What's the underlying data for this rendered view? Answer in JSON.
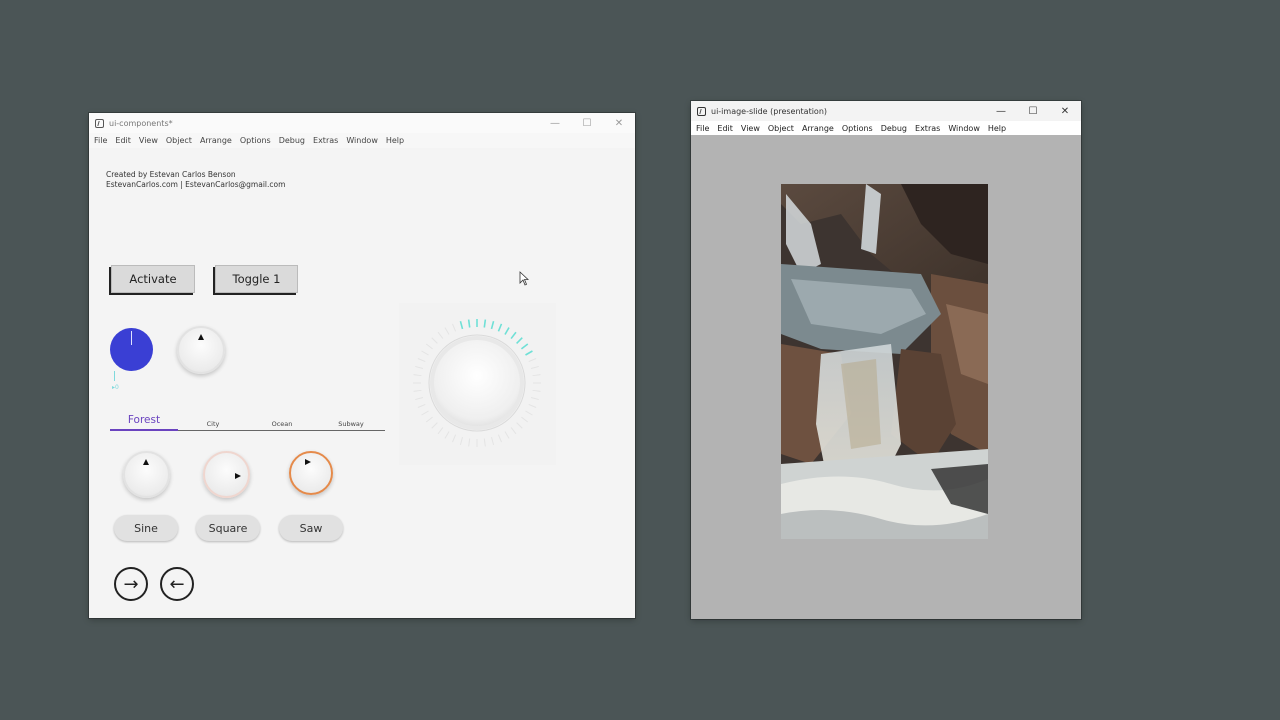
{
  "window1": {
    "title": "ui-components*",
    "menu": [
      "File",
      "Edit",
      "View",
      "Object",
      "Arrange",
      "Options",
      "Debug",
      "Extras",
      "Window",
      "Help"
    ],
    "credit_line1": "Created by Estevan Carlos Benson",
    "credit_line2": "EstevanCarlos.com | EstevanCarlos@gmail.com",
    "buttons": {
      "activate": "Activate",
      "toggle": "Toggle 1"
    },
    "small_knob_label": "0",
    "tabs": [
      "Forest",
      "City",
      "Ocean",
      "Subway"
    ],
    "active_tab": "Forest",
    "waveforms": [
      "Sine",
      "Square",
      "Saw"
    ],
    "nav": {
      "forward_icon": "arrow-right-icon",
      "back_icon": "arrow-left-icon"
    },
    "colors": {
      "blue_knob": "#3a3fd4",
      "tab_accent": "#6a43bf",
      "knob_ticks": "#6fe0d6"
    }
  },
  "window2": {
    "title": "ui-image-slide (presentation)",
    "menu": [
      "File",
      "Edit",
      "View",
      "Object",
      "Arrange",
      "Options",
      "Debug",
      "Extras",
      "Window",
      "Help"
    ],
    "image_subject": "waterfall over rocks"
  }
}
